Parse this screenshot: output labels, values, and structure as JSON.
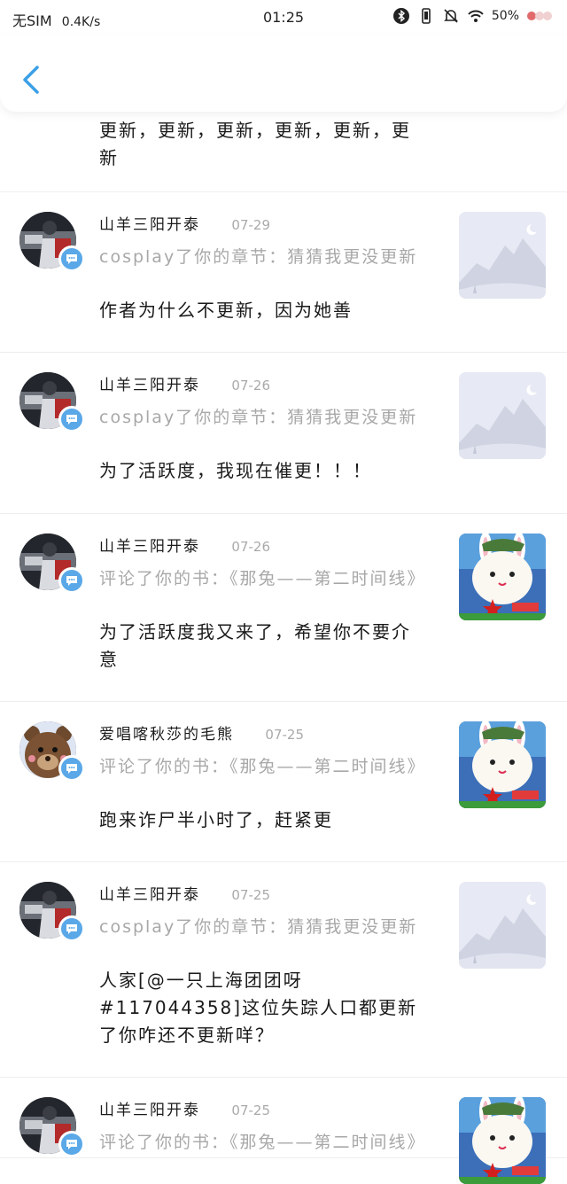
{
  "status_bar": {
    "carrier": "无SIM",
    "speed": "0.4K/s",
    "time": "01:25",
    "battery": "50%",
    "icons": [
      "bluetooth-icon",
      "vibrate-icon",
      "mute-icon",
      "wifi-icon",
      "battery-icon"
    ]
  },
  "header": {
    "back_icon": "chevron-left-icon",
    "accent": "#3ba0e6"
  },
  "top_comment": "更新，更新，更新，更新，更新，更新",
  "notifications": [
    {
      "user": "山羊三阳开泰",
      "date": "07-29",
      "action": "cosplay了你的章节：猜猜我更没更新",
      "comment": "作者为什么不更新，因为她善",
      "avatar": "dark-portrait",
      "thumb": "placeholder-mountain"
    },
    {
      "user": "山羊三阳开泰",
      "date": "07-26",
      "action": "cosplay了你的章节：猜猜我更没更新",
      "comment": "为了活跃度，我现在催更！！！",
      "avatar": "dark-portrait",
      "thumb": "placeholder-mountain"
    },
    {
      "user": "山羊三阳开泰",
      "date": "07-26",
      "action": "评论了你的书：《那兔——第二时间线》",
      "comment": "为了活跃度我又来了，希望你不要介意",
      "avatar": "dark-portrait",
      "thumb": "rabbit-cover"
    },
    {
      "user": "爱唱喀秋莎的毛熊",
      "date": "07-25",
      "action": "评论了你的书：《那兔——第二时间线》",
      "comment": "跑来诈尸半小时了，赶紧更",
      "avatar": "bear",
      "thumb": "rabbit-cover"
    },
    {
      "user": "山羊三阳开泰",
      "date": "07-25",
      "action": "cosplay了你的章节：猜猜我更没更新",
      "comment": "人家[@一只上海团团呀#117044358]这位失踪人口都更新了你咋还不更新咩？",
      "avatar": "dark-portrait",
      "thumb": "placeholder-mountain"
    },
    {
      "user": "山羊三阳开泰",
      "date": "07-25",
      "action": "评论了你的书：《那兔——第二时间线》",
      "comment": "",
      "avatar": "dark-portrait",
      "thumb": "rabbit-cover"
    }
  ]
}
